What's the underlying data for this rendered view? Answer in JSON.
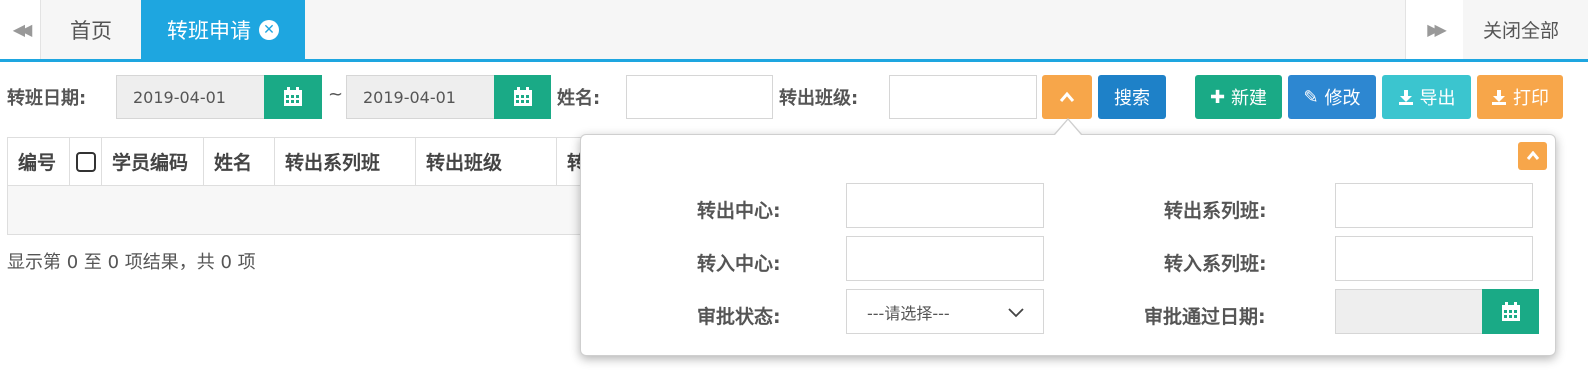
{
  "tabs": {
    "home_label": "首页",
    "active_label": "转班申请",
    "close_all_label": "关闭全部"
  },
  "filters": {
    "date_label": "转班日期:",
    "date_from": "2019-04-01",
    "date_separator": "~",
    "date_to": "2019-04-01",
    "name_label": "姓名:",
    "name_value": "",
    "out_class_label": "转出班级:",
    "out_class_value": ""
  },
  "toolbar": {
    "search_label": "搜索",
    "new_label": "新建",
    "edit_label": "修改",
    "export_label": "导出",
    "print_label": "打印"
  },
  "table": {
    "columns": [
      "编号",
      "",
      "学员编码",
      "姓名",
      "转出系列班",
      "转出班级",
      "转"
    ],
    "result_info": "显示第 0 至 0 项结果，共 0 项"
  },
  "advanced": {
    "out_center_label": "转出中心:",
    "out_series_label": "转出系列班:",
    "in_center_label": "转入中心:",
    "in_series_label": "转入系列班:",
    "status_label": "审批状态:",
    "status_selected": "---请选择---",
    "approve_date_label": "审批通过日期:"
  },
  "colors": {
    "accent_blue": "#1ea6e0",
    "green": "#1aaa86",
    "orange": "#f7a64a",
    "search_blue": "#1e81c8",
    "cyan": "#3bc5cf"
  },
  "icons": {
    "prev": "double-chevron-left-icon",
    "next": "double-chevron-right-icon",
    "tab_close": "close-circle-icon",
    "calendar": "calendar-icon",
    "toggle": "chevron-up-icon",
    "new": "plus-icon",
    "edit": "pencil-icon",
    "export": "download-icon",
    "print": "download-icon",
    "select": "chevron-down-icon"
  }
}
